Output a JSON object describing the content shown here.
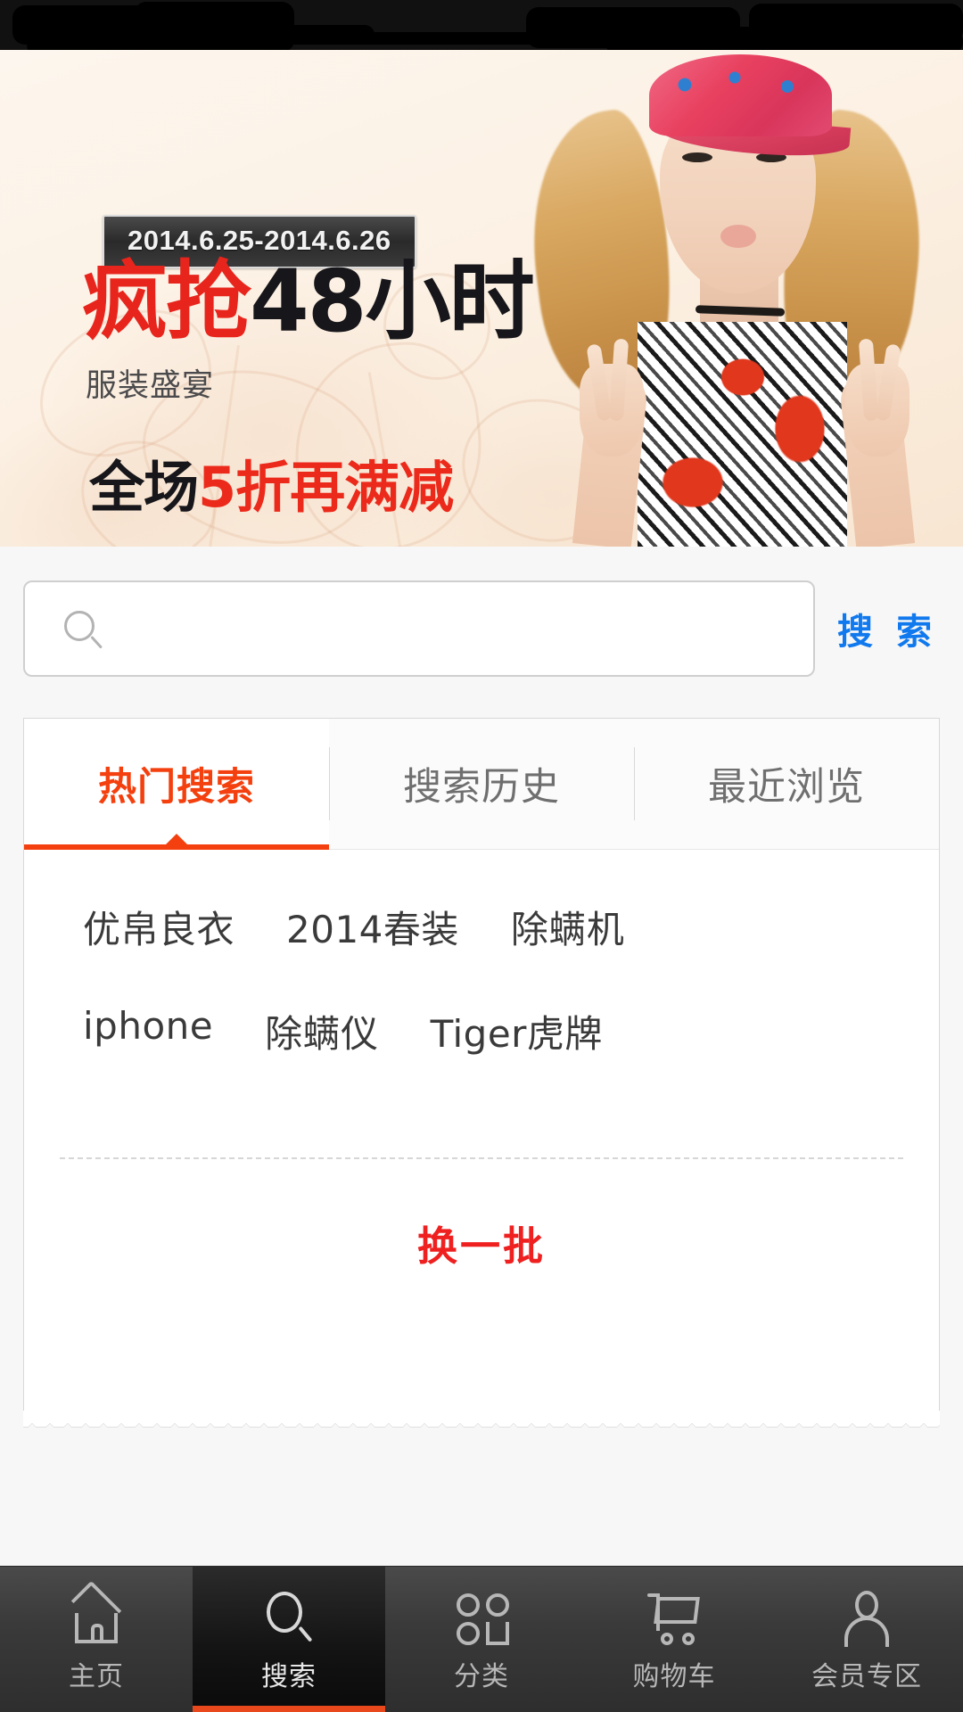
{
  "statusbar": {
    "redacted": true
  },
  "banner": {
    "date_range": "2014.6.25-2014.6.26",
    "headline_red": "疯抢",
    "headline_dark": "48小时",
    "subline": "服装盛宴",
    "promo_dark": "全场",
    "promo_red": "5折再满减",
    "accent_red": "#e8251c",
    "bg_color": "#fcf1e4"
  },
  "search": {
    "placeholder": "",
    "value": "",
    "icon": "search-icon",
    "button_label": "搜 索",
    "button_color": "#1179ee"
  },
  "panel": {
    "tabs": [
      {
        "label": "热门搜索",
        "active": true
      },
      {
        "label": "搜索历史",
        "active": false
      },
      {
        "label": "最近浏览",
        "active": false
      }
    ],
    "active_color": "#f4400e",
    "keyword_rows": [
      [
        "优帛良衣",
        "2014春装",
        "除螨机"
      ],
      [
        "iphone",
        "除螨仪",
        "Tiger虎牌"
      ]
    ],
    "refresh_label": "换一批",
    "refresh_color": "#ef2020"
  },
  "tabbar": {
    "active_accent": "#e8481c",
    "items": [
      {
        "label": "主页",
        "icon": "home-icon",
        "active": false
      },
      {
        "label": "搜索",
        "icon": "search-icon",
        "active": true
      },
      {
        "label": "分类",
        "icon": "grid-icon",
        "active": false
      },
      {
        "label": "购物车",
        "icon": "cart-icon",
        "active": false
      },
      {
        "label": "会员专区",
        "icon": "user-icon",
        "active": false
      }
    ]
  }
}
